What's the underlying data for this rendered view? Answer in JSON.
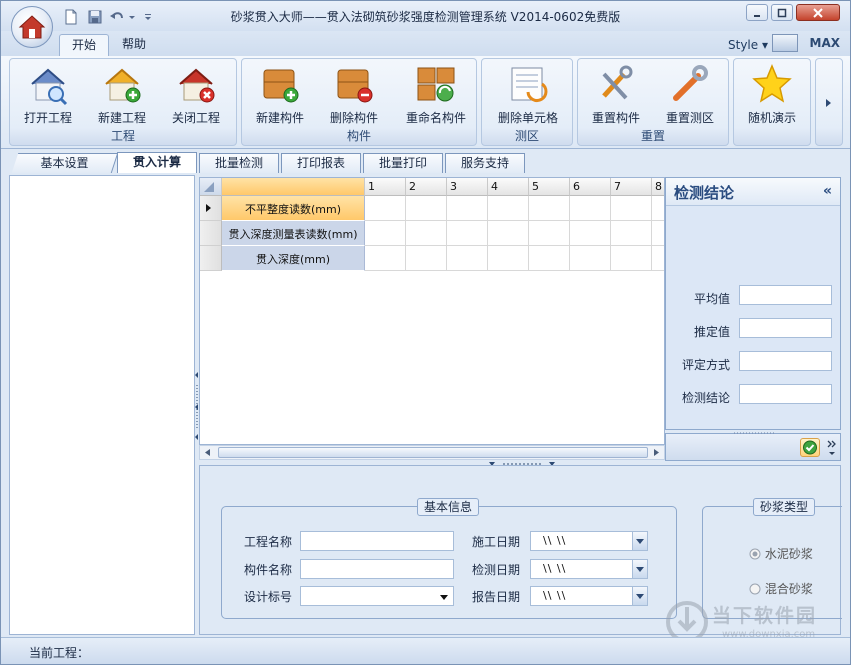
{
  "window": {
    "title": "砂浆贯入大师——贯入法砌筑砂浆强度检测管理系统  V2014-0602免费版"
  },
  "ribbon_tabs": [
    {
      "label": "开始"
    },
    {
      "label": "帮助"
    }
  ],
  "style_menu": {
    "label": "Style",
    "max_label": "MAX"
  },
  "groups": {
    "project": "工程",
    "member": "构件",
    "zone": "测区",
    "reset": "重置"
  },
  "buttons": {
    "open_project": "打开工程",
    "new_project": "新建工程",
    "close_project": "关闭工程",
    "new_member": "新建构件",
    "delete_member": "删除构件",
    "rename_member": "重命名构件",
    "delete_cell": "删除单元格",
    "reset_member": "重置构件",
    "reset_zone": "重置测区",
    "random_demo": "随机演示"
  },
  "doc_tabs": [
    {
      "label": "基本设置"
    },
    {
      "label": "贯入计算"
    },
    {
      "label": "批量检测"
    },
    {
      "label": "打印报表"
    },
    {
      "label": "批量打印"
    },
    {
      "label": "服务支持"
    }
  ],
  "grid": {
    "columns": [
      "1",
      "2",
      "3",
      "4",
      "5",
      "6",
      "7",
      "8"
    ],
    "rows": [
      {
        "label": "不平整度读数(mm)"
      },
      {
        "label": "贯入深度测量表读数(mm)"
      },
      {
        "label": "贯入深度(mm)"
      }
    ]
  },
  "result_panel": {
    "title": "检测结论",
    "collapse_glyph": "«",
    "fields": [
      {
        "label": "平均值",
        "value": ""
      },
      {
        "label": "推定值",
        "value": ""
      },
      {
        "label": "评定方式",
        "value": ""
      },
      {
        "label": "检测结论",
        "value": ""
      }
    ]
  },
  "basic_info": {
    "title": "基本信息",
    "project_name": {
      "label": "工程名称",
      "value": ""
    },
    "member_name": {
      "label": "构件名称",
      "value": ""
    },
    "design_grade": {
      "label": "设计标号",
      "value": ""
    },
    "construction_date": {
      "label": "施工日期",
      "value": "\\\\  \\\\"
    },
    "test_date": {
      "label": "检测日期",
      "value": "\\\\  \\\\"
    },
    "report_date": {
      "label": "报告日期",
      "value": "\\\\  \\\\"
    }
  },
  "mortar_type": {
    "title": "砂浆类型",
    "options": [
      {
        "label": "水泥砂浆",
        "selected": true
      },
      {
        "label": "混合砂浆",
        "selected": false
      }
    ]
  },
  "status": {
    "current_project": "当前工程："
  },
  "watermark": {
    "text": "当下软件园",
    "url": "www.downxia.com"
  }
}
